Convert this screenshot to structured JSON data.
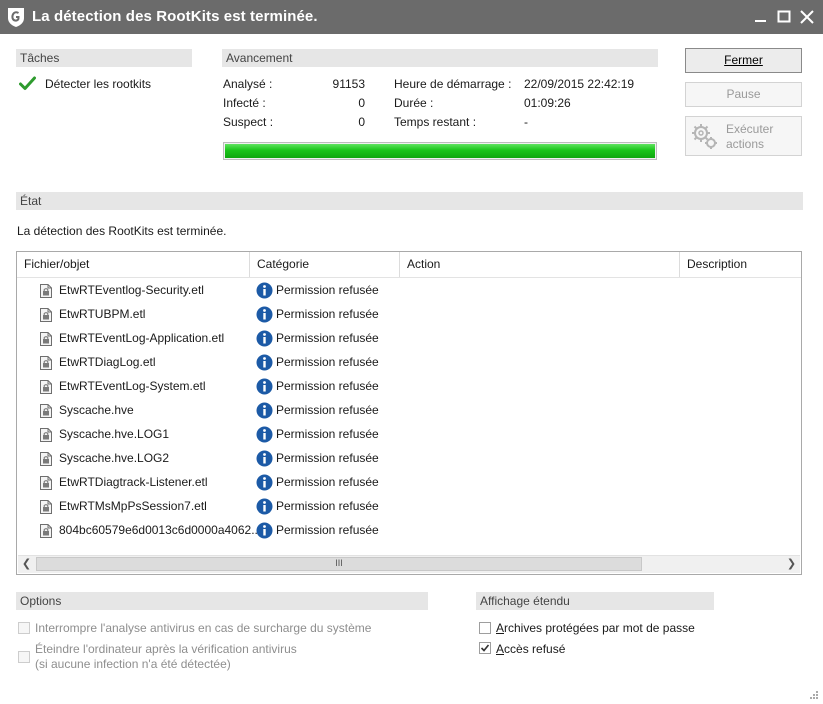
{
  "window": {
    "title": "La détection des RootKits est terminée."
  },
  "tasks": {
    "header": "Tâches",
    "items": [
      {
        "label": "Détecter les rootkits"
      }
    ]
  },
  "progress": {
    "header": "Avancement",
    "analyzed_label": "Analysé :",
    "analyzed_value": "91153",
    "infected_label": "Infecté :",
    "infected_value": "0",
    "suspect_label": "Suspect :",
    "suspect_value": "0",
    "start_label": "Heure de démarrage :",
    "start_value": "22/09/2015 22:42:19",
    "duration_label": "Durée :",
    "duration_value": "01:09:26",
    "remaining_label": "Temps restant :",
    "remaining_value": "-",
    "bar_fraction": 1.0
  },
  "buttons": {
    "close": "Fermer",
    "pause": "Pause",
    "execute_line1": "Exécuter",
    "execute_line2": "actions"
  },
  "state": {
    "header": "État",
    "message": "La détection des RootKits est terminée."
  },
  "table": {
    "columns": [
      "Fichier/objet",
      "Catégorie",
      "Action",
      "Description"
    ],
    "rows": [
      {
        "file": "EtwRTEventlog-Security.etl",
        "category": "Permission refusée"
      },
      {
        "file": "EtwRTUBPM.etl",
        "category": "Permission refusée"
      },
      {
        "file": "EtwRTEventLog-Application.etl",
        "category": "Permission refusée"
      },
      {
        "file": "EtwRTDiagLog.etl",
        "category": "Permission refusée"
      },
      {
        "file": "EtwRTEventLog-System.etl",
        "category": "Permission refusée"
      },
      {
        "file": "Syscache.hve",
        "category": "Permission refusée"
      },
      {
        "file": "Syscache.hve.LOG1",
        "category": "Permission refusée"
      },
      {
        "file": "Syscache.hve.LOG2",
        "category": "Permission refusée"
      },
      {
        "file": "EtwRTDiagtrack-Listener.etl",
        "category": "Permission refusée"
      },
      {
        "file": "EtwRTMsMpPsSession7.etl",
        "category": "Permission refusée"
      },
      {
        "file": "804bc60579e6d0013c6d0000a4062...",
        "category": "Permission refusée"
      }
    ],
    "scroll_thumb_glyph": "III"
  },
  "options": {
    "header": "Options",
    "items": [
      {
        "line1": "Interrompre l'analyse antivirus en cas de surcharge du système",
        "line2": "",
        "checked": false
      },
      {
        "line1": "Éteindre l'ordinateur après la vérification antivirus",
        "line2": "(si aucune infection n'a été détectée)",
        "checked": false
      }
    ]
  },
  "extended": {
    "header": "Affichage étendu",
    "items": [
      {
        "label": "Archives protégées par mot de passe",
        "checked": false
      },
      {
        "label": "Accès refusé",
        "checked": true
      }
    ]
  },
  "colors": {
    "titlebar": "#6b6b6b",
    "progress_green": "#19c419",
    "info_blue": "#1c5aa6",
    "check_green": "#2e9b2e"
  },
  "icons": {
    "app": "gdata-shield-icon",
    "file": "locked-file-icon",
    "category": "info-icon",
    "task_done": "checkmark-icon"
  }
}
